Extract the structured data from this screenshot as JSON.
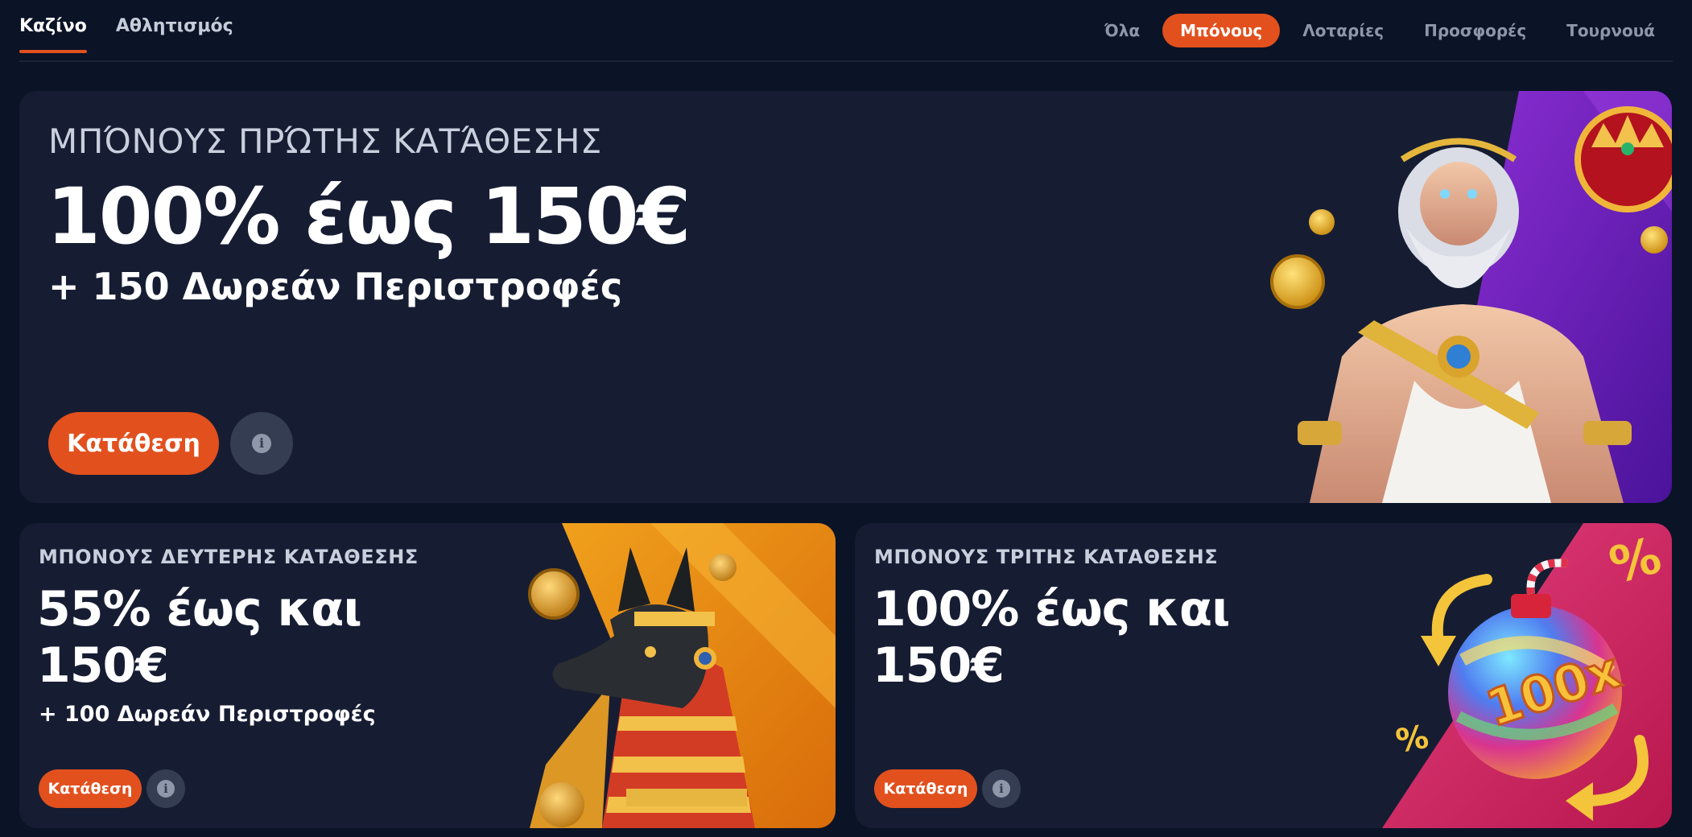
{
  "nav": {
    "main_tabs": [
      {
        "label": "Καζίνο",
        "active": true
      },
      {
        "label": "Αθλητισμός",
        "active": false
      }
    ],
    "filters": [
      {
        "label": "Όλα",
        "active": false
      },
      {
        "label": "Μπόνους",
        "active": true
      },
      {
        "label": "Λοταρίες",
        "active": false
      },
      {
        "label": "Προσφορές",
        "active": false
      },
      {
        "label": "Τουρνουά",
        "active": false
      }
    ]
  },
  "hero": {
    "eyebrow": "ΜΠΌΝΟΥΣ ΠΡΏΤΗΣ ΚΑΤΆΘΕΣΗΣ",
    "headline": "100% έως 150€",
    "subline": "+ 150 Δωρεάν Περιστροφές",
    "deposit_label": "Κατάθεση",
    "info_glyph": "i",
    "art_icon": "zeus-illustration"
  },
  "second": {
    "eyebrow": "ΜΠΟΝΟΥΣ ΔΕΥΤΕΡΗΣ ΚΑΤΑΘΕΣΗΣ",
    "headline": "55% έως και 150€",
    "subline": "+ 100 Δωρεάν Περιστροφές",
    "deposit_label": "Κατάθεση",
    "info_glyph": "i",
    "art_icon": "anubis-illustration"
  },
  "third": {
    "eyebrow": "ΜΠΟΝΟΥΣ ΤΡΙΤΗΣ ΚΑΤΑΘΕΣΗΣ",
    "headline": "100% έως και 150€",
    "deposit_label": "Κατάθεση",
    "info_glyph": "i",
    "art_icon": "candy-bomb-illustration",
    "art_text": "100x"
  },
  "colors": {
    "background": "#0b1327",
    "card": "#161d33",
    "accent": "#e2501e",
    "info_button": "#353d52"
  }
}
